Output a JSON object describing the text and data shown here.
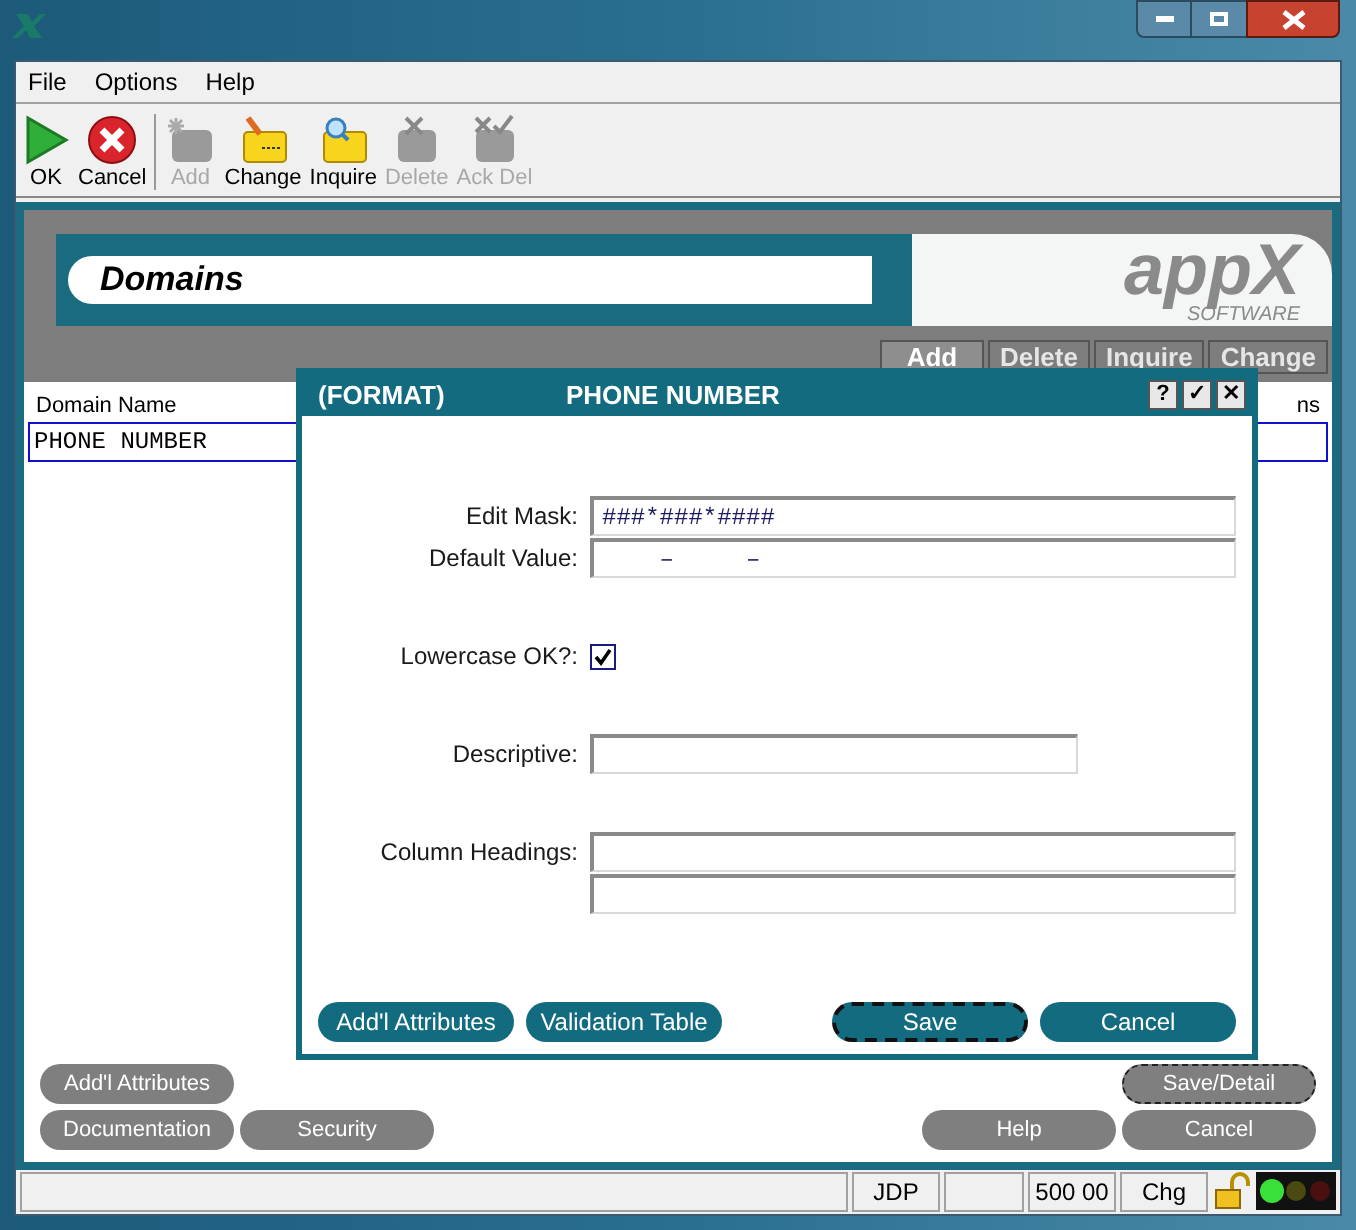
{
  "menu": [
    "File",
    "Options",
    "Help"
  ],
  "toolbar": [
    {
      "label": "OK",
      "kind": "ok",
      "disabled": false
    },
    {
      "label": "Cancel",
      "kind": "cancel",
      "disabled": false
    },
    {
      "label": "Add",
      "kind": "add",
      "disabled": true
    },
    {
      "label": "Change",
      "kind": "change",
      "disabled": false
    },
    {
      "label": "Inquire",
      "kind": "inquire",
      "disabled": false
    },
    {
      "label": "Delete",
      "kind": "delete",
      "disabled": true
    },
    {
      "label": "Ack Del",
      "kind": "ackdel",
      "disabled": true
    }
  ],
  "panel": {
    "title": "Domains",
    "logo": "appX",
    "logo_sub": "SOFTWARE",
    "actions": [
      {
        "label": "Add",
        "disabled": true
      },
      {
        "label": "Delete",
        "disabled": false
      },
      {
        "label": "Inquire",
        "disabled": false
      },
      {
        "label": "Change",
        "disabled": false
      }
    ]
  },
  "list": {
    "columns": [
      "Domain Name",
      "ns"
    ],
    "rows": [
      {
        "cells": [
          "PHONE NUMBER"
        ],
        "selected": true
      }
    ]
  },
  "footer": {
    "rows": [
      {
        "left": [
          {
            "label": "Add'l Attributes",
            "focused": false
          }
        ],
        "right": [
          {
            "label": "Save/Detail",
            "focused": true
          }
        ]
      },
      {
        "left": [
          {
            "label": "Documentation",
            "focused": false
          },
          {
            "label": "Security",
            "focused": false
          }
        ],
        "right": [
          {
            "label": "Help",
            "focused": false
          },
          {
            "label": "Cancel",
            "focused": false
          }
        ]
      }
    ]
  },
  "dialog": {
    "title": "(FORMAT)",
    "subtitle": "PHONE NUMBER",
    "title_buttons": [
      "?",
      "✓",
      "✕"
    ],
    "groups": [
      [
        {
          "kind": "text",
          "label": "Edit Mask:",
          "value": "###*###*####"
        },
        {
          "kind": "text",
          "label": "Default Value:",
          "value": "    –     –"
        }
      ],
      [
        {
          "kind": "checkbox",
          "label": "Lowercase OK?:",
          "checked": true
        }
      ],
      [
        {
          "kind": "short",
          "label": "Descriptive:"
        }
      ],
      [
        {
          "kind": "text",
          "label": "Column Headings:"
        },
        {
          "kind": "text"
        }
      ]
    ],
    "buttons": [
      {
        "label": "Add'l Attributes",
        "focused": false
      },
      {
        "label": "Validation Table",
        "focused": false
      }
    ],
    "actions": [
      {
        "label": "Save",
        "focused": true
      },
      {
        "label": "Cancel",
        "focused": false
      }
    ]
  },
  "status_bar": [
    "JDP",
    "500 00",
    "Chg"
  ]
}
